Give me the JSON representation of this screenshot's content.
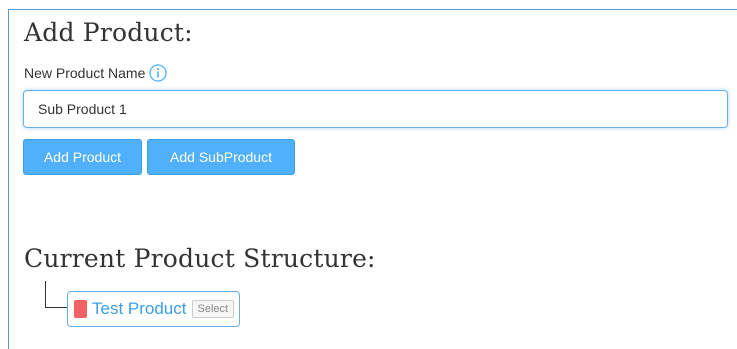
{
  "add_product": {
    "heading": "Add Product:",
    "field_label": "New Product Name",
    "name_input_value": "Sub Product 1",
    "add_product_button": "Add Product",
    "add_subproduct_button": "Add SubProduct"
  },
  "structure": {
    "heading": "Current Product Structure:",
    "nodes": [
      {
        "name": "Test Product",
        "color": "#f06263",
        "select_label": "Select"
      }
    ]
  },
  "colors": {
    "accent": "#50b0fb",
    "focus_border": "#66afe9",
    "node_marker": "#f06263"
  },
  "icons": {
    "field_help": "info-icon"
  }
}
